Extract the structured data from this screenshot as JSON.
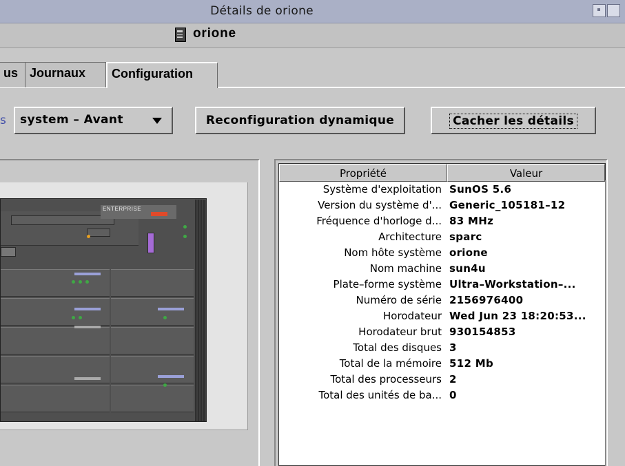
{
  "window": {
    "title": "Détails de orione",
    "host_name": "orione"
  },
  "tabs": [
    {
      "label": "us",
      "active": false
    },
    {
      "label": "Journaux",
      "active": false
    },
    {
      "label": "Configuration",
      "active": true
    }
  ],
  "controls": {
    "view_label_tail": "s",
    "view_select_value": "system – Avant",
    "dynamic_reconfig_label": "Reconfiguration dynamique",
    "hide_details_label": "Cacher les détails"
  },
  "hardware_image": {
    "logo_text": "ENTERPRISE"
  },
  "properties_table": {
    "columns": [
      "Propriété",
      "Valeur"
    ],
    "rows": [
      {
        "property": "Système d'exploitation",
        "value": "SunOS 5.6"
      },
      {
        "property": "Version du système d'...",
        "value": "Generic_105181–12"
      },
      {
        "property": "Fréquence d'horloge d...",
        "value": "83 MHz"
      },
      {
        "property": "Architecture",
        "value": "sparc"
      },
      {
        "property": "Nom hôte système",
        "value": "orione"
      },
      {
        "property": "Nom machine",
        "value": "sun4u"
      },
      {
        "property": "Plate–forme système",
        "value": "Ultra–Workstation–..."
      },
      {
        "property": "Numéro de série",
        "value": "2156976400"
      },
      {
        "property": "Horodateur",
        "value": "Wed Jun 23 18:20:53..."
      },
      {
        "property": "Horodateur brut",
        "value": "930154853"
      },
      {
        "property": "Total des disques",
        "value": "3"
      },
      {
        "property": "Total de la mémoire",
        "value": "512 Mb"
      },
      {
        "property": "Total des processeurs",
        "value": "2"
      },
      {
        "property": "Total des unités de ba...",
        "value": "0"
      }
    ]
  },
  "colors": {
    "titlebar": "#aab0c6",
    "panel": "#c8c8c8",
    "table_bg": "#ffffff",
    "key_purple": "#a56bd6",
    "led_green": "#3fa845",
    "led_orange": "#e8a020"
  }
}
